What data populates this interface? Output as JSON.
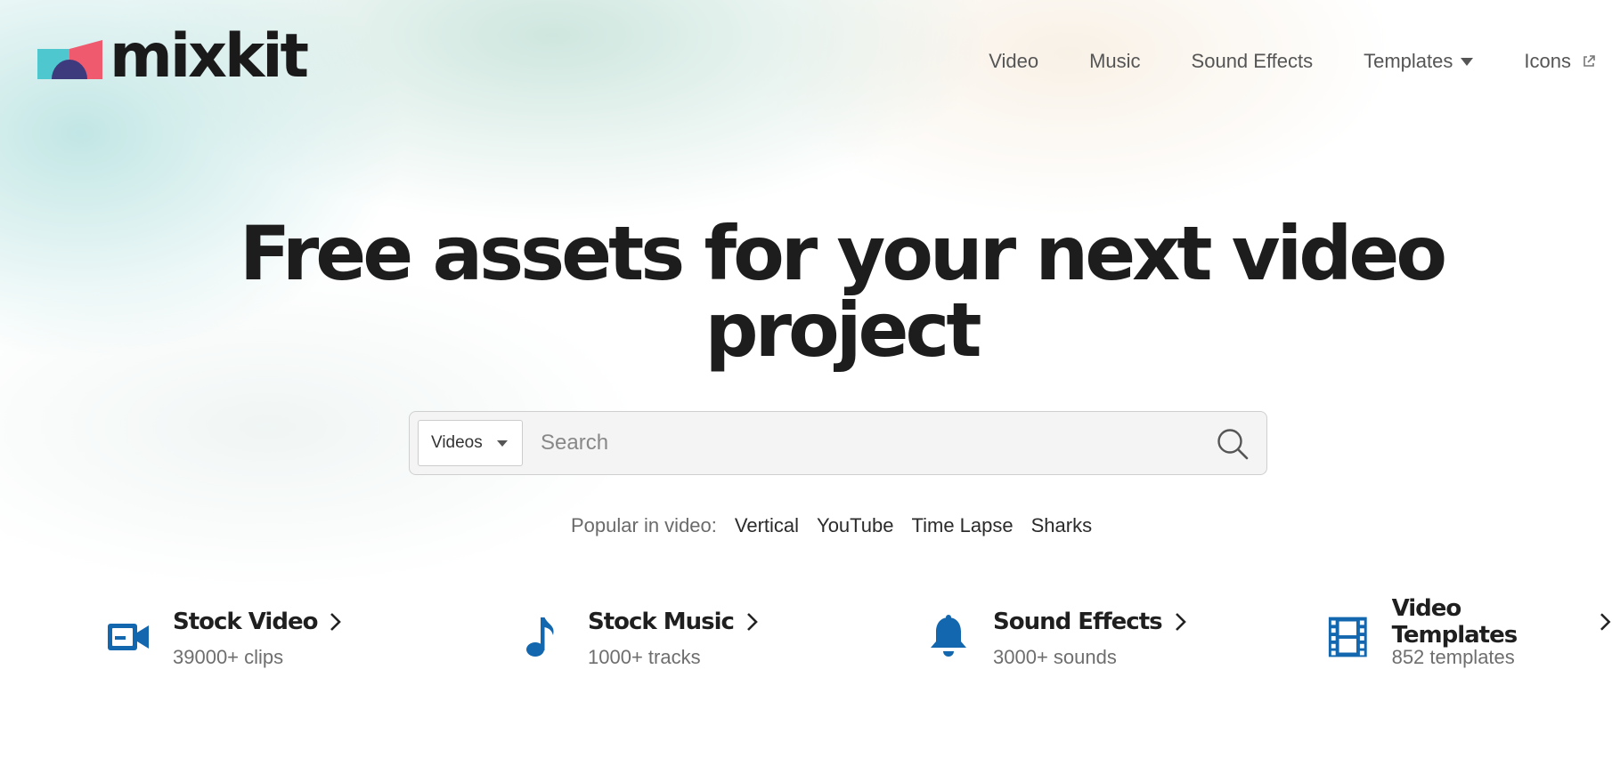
{
  "brand": {
    "name": "mixkit",
    "colors": {
      "teal": "#4fc7cf",
      "indigo": "#3d3a7e",
      "coral": "#ef5a6f",
      "accent_blue": "#1367ae"
    }
  },
  "nav": {
    "items": [
      {
        "label": "Video"
      },
      {
        "label": "Music"
      },
      {
        "label": "Sound Effects"
      },
      {
        "label": "Templates",
        "icon": "caret-down-icon"
      },
      {
        "label": "Icons",
        "icon": "external-link-icon"
      }
    ]
  },
  "hero": {
    "title_line1": "Free assets for your next video",
    "title_line2": "project"
  },
  "search": {
    "category_selected": "Videos",
    "placeholder": "Search",
    "value": "",
    "button_icon": "search-icon"
  },
  "popular": {
    "label": "Popular in video:",
    "links": [
      "Vertical",
      "YouTube",
      "Time Lapse",
      "Sharks"
    ]
  },
  "categories": [
    {
      "title": "Stock Video",
      "count": "39000+ clips",
      "icon": "video-camera-icon"
    },
    {
      "title": "Stock Music",
      "count": "1000+ tracks",
      "icon": "music-note-icon"
    },
    {
      "title": "Sound Effects",
      "count": "3000+ sounds",
      "icon": "bell-icon"
    },
    {
      "title": "Video Templates",
      "count": "852 templates",
      "icon": "film-strip-icon"
    }
  ]
}
